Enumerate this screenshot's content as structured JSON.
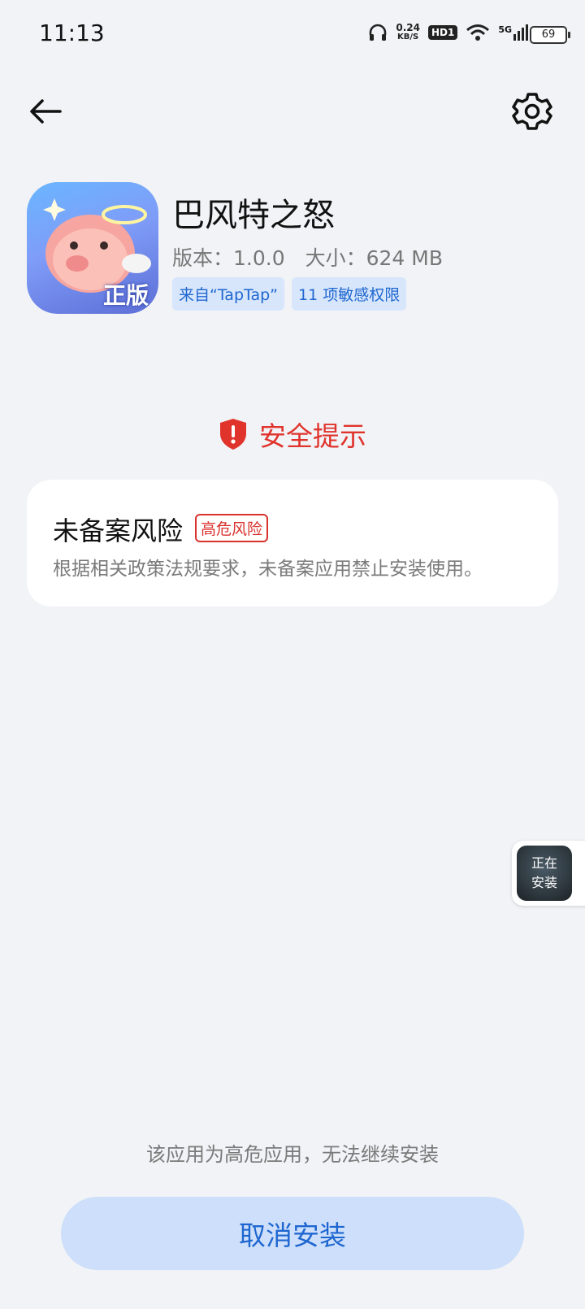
{
  "status_bar": {
    "time": "11:13",
    "net_speed_value": "0.24",
    "net_speed_unit": "KB/S",
    "hd_label": "HD1",
    "network_label": "5G",
    "battery": "69"
  },
  "header": {
    "back_icon": "arrow-left-icon",
    "settings_icon": "gear-icon"
  },
  "app": {
    "name": "巴风特之怒",
    "meta": "版本：1.0.0　大小：624 MB",
    "tags": [
      "来自“TapTap”",
      "11 项敏感权限"
    ],
    "icon_badge": "正版"
  },
  "warning": {
    "title": "安全提示",
    "icon": "shield-alert-icon",
    "accent": "#e0332c"
  },
  "risk_card": {
    "title": "未备案风险",
    "badge": "高危风险",
    "description": "根据相关政策法规要求，未备案应用禁止安装使用。"
  },
  "installing_float": {
    "line1": "正在",
    "line2": "安装"
  },
  "footer": {
    "note": "该应用为高危应用，无法继续安装",
    "cancel_label": "取消安装",
    "button_color": "#cddffa",
    "button_text_color": "#1f67d0"
  }
}
